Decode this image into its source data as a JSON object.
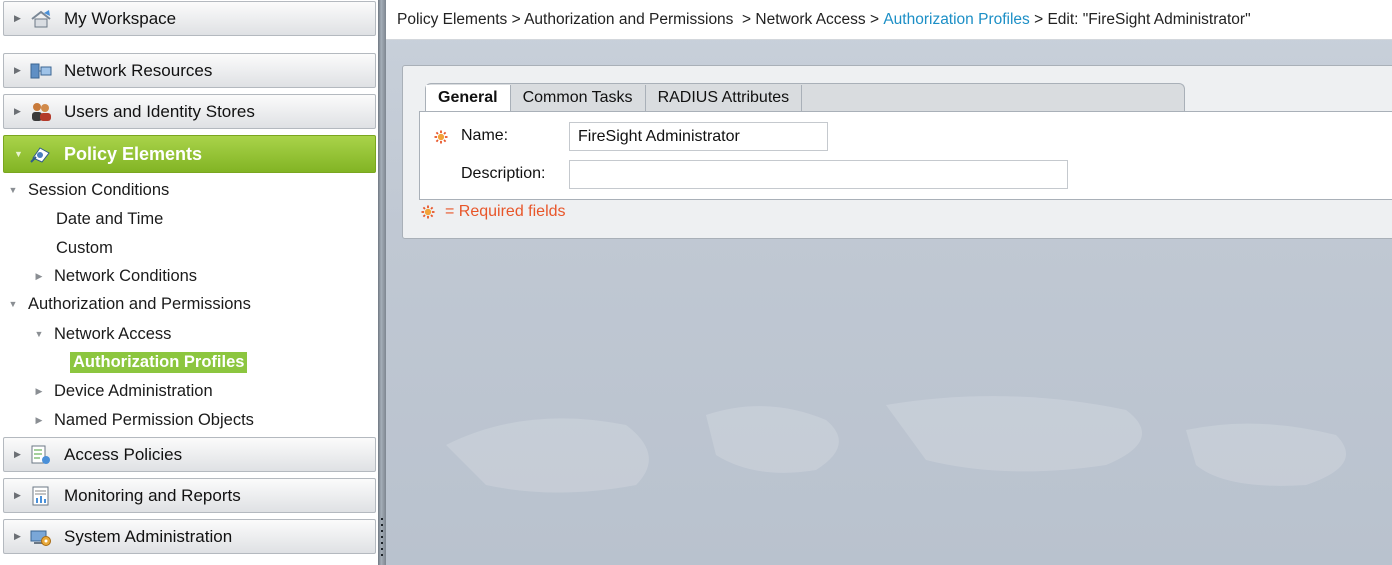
{
  "sidebar": {
    "drawers": [
      {
        "label": "My Workspace",
        "icon": "workspace-icon",
        "expanded": false
      },
      {
        "label": "Network Resources",
        "icon": "network-resources-icon",
        "expanded": false
      },
      {
        "label": "Users and Identity Stores",
        "icon": "users-icon",
        "expanded": false
      },
      {
        "label": "Policy Elements",
        "icon": "policy-elements-icon",
        "expanded": true
      },
      {
        "label": "Access Policies",
        "icon": "access-policies-icon",
        "expanded": false
      },
      {
        "label": "Monitoring and Reports",
        "icon": "monitoring-icon",
        "expanded": false
      },
      {
        "label": "System Administration",
        "icon": "system-admin-icon",
        "expanded": false
      }
    ],
    "tree": [
      {
        "label": "Session Conditions",
        "toggle": "expanded"
      },
      {
        "label": "Date and Time",
        "toggle": "none"
      },
      {
        "label": "Custom",
        "toggle": "none"
      },
      {
        "label": "Network Conditions",
        "toggle": "collapsed"
      },
      {
        "label": "Authorization and Permissions",
        "toggle": "expanded"
      },
      {
        "label": "Network Access",
        "toggle": "expanded"
      },
      {
        "label": "Authorization Profiles",
        "toggle": "none",
        "selected": true
      },
      {
        "label": "Device Administration",
        "toggle": "collapsed"
      },
      {
        "label": "Named Permission Objects",
        "toggle": "collapsed"
      }
    ]
  },
  "breadcrumb": {
    "part1": "Policy Elements > Authorization and Permissions  > Network Access > ",
    "link": "Authorization Profiles",
    "part2": " > Edit: \"FireSight Administrator\""
  },
  "tabs": [
    "General",
    "Common Tasks",
    "RADIUS Attributes"
  ],
  "form": {
    "name_label": "Name:",
    "name_value": "FireSight Administrator",
    "description_label": "Description:",
    "description_value": "",
    "required_note": "= Required fields"
  },
  "colors": {
    "accent_green": "#8cc63f",
    "link_blue": "#1c8fc6",
    "required_orange": "#e8562a"
  }
}
